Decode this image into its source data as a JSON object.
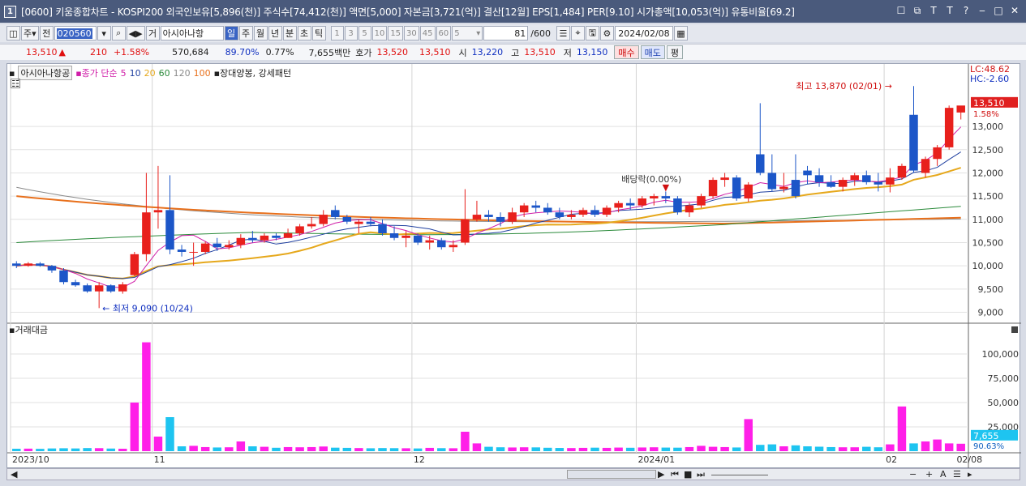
{
  "title": {
    "text": "[0600] 키움종합차트 - KOSPI200 외국인보유[5,896(천)] 주식수[74,412(천)] 액면[5,000] 자본금[3,721(억)] 결산[12월] EPS[1,484] PER[9.10] 시가총액[10,053(억)] 유통비율[69.2]",
    "icon": "1"
  },
  "toolbar": {
    "ju": "주",
    "jeon": "전",
    "code": "020560",
    "ge": "거",
    "stock_name": "아시아나항",
    "periods": [
      "일",
      "주",
      "월",
      "년",
      "분",
      "초",
      "틱"
    ],
    "active_period": "일",
    "numbers": [
      "1",
      "3",
      "5",
      "10",
      "15",
      "30",
      "45",
      "60"
    ],
    "n_value": "5",
    "count": "81",
    "count_total": "/600",
    "date": "2024/02/08"
  },
  "quote": {
    "price": "13,510",
    "change_arrow": "▲",
    "change": "210",
    "change_pct": "+1.58%",
    "volume": "570,684",
    "vol_ratio": "89.70%",
    "turnover": "0.77%",
    "amount": "7,655백만",
    "hoga_label": "호가",
    "ask": "13,520",
    "bid": "13,510",
    "open_label": "시",
    "open": "13,220",
    "high_label": "고",
    "high": "13,510",
    "low_label": "저",
    "low": "13,150",
    "buy_btn": "매수",
    "sell_btn": "매도",
    "eval_btn": "평"
  },
  "legend": {
    "name": "아시아나항공",
    "ma_label": "종가 단순",
    "ma": [
      "5",
      "10",
      "20",
      "60",
      "120",
      "100"
    ],
    "pattern": "장대양봉, 강세패턴",
    "volume_label": "거래대금"
  },
  "annotations": {
    "high": "최고 13,870 (02/01)",
    "low": "최저 9,090 (10/24)",
    "dividend": "배당락(0.00%)",
    "lc": "LC:48.62",
    "hc": "HC:-2.60",
    "last_price": "13,510",
    "last_pct": "1.58%",
    "last_vol": "7,655",
    "last_vol_pct": "90.63%"
  },
  "colors": {
    "up": "#e8201c",
    "down": "#1c56c8",
    "ma5": "#d01ea8",
    "ma10": "#2040a0",
    "ma20": "#e6a81c",
    "ma60": "#2a8a3a",
    "ma120": "#8a8a8a",
    "ma100": "#e8701c",
    "vol_up": "#ff1fe8",
    "vol_down": "#1ec4f0"
  },
  "chart_data": {
    "type": "candlestick",
    "price_ticks": [
      9000,
      9500,
      10000,
      10500,
      11000,
      11500,
      12000,
      12500,
      13000
    ],
    "price_tick_labels": [
      "9,000",
      "9,500",
      "10,000",
      "10,500",
      "11,000",
      "11,500",
      "12,000",
      "12,500",
      "13,000"
    ],
    "ylim": [
      8800,
      14100
    ],
    "volume_ticks": [
      25000,
      50000,
      75000,
      100000
    ],
    "volume_tick_labels": [
      "25,000",
      "50,000",
      "75,000",
      "100,000"
    ],
    "vol_ylim": [
      0,
      120000
    ],
    "x_labels": [
      {
        "index": 0,
        "text": "2023/10"
      },
      {
        "index": 12,
        "text": "11"
      },
      {
        "index": 34,
        "text": "12"
      },
      {
        "index": 53,
        "text": "2024/01"
      },
      {
        "index": 74,
        "text": "02"
      },
      {
        "index": 80,
        "text": "02/08"
      }
    ],
    "candles": [
      [
        10050,
        10100,
        9950,
        10000,
        2500
      ],
      [
        10000,
        10080,
        9980,
        10050,
        2600
      ],
      [
        10050,
        10080,
        9980,
        10000,
        2400
      ],
      [
        10000,
        10020,
        9850,
        9900,
        2800
      ],
      [
        9900,
        9950,
        9600,
        9650,
        3000
      ],
      [
        9650,
        9700,
        9550,
        9580,
        2800
      ],
      [
        9580,
        9620,
        9420,
        9450,
        3200
      ],
      [
        9450,
        9650,
        9090,
        9580,
        3100
      ],
      [
        9580,
        9600,
        9420,
        9450,
        2700
      ],
      [
        9450,
        9650,
        9400,
        9600,
        2500
      ],
      [
        9800,
        10300,
        9780,
        10250,
        50000
      ],
      [
        10250,
        12000,
        10100,
        11150,
        112000
      ],
      [
        11150,
        12150,
        10800,
        11200,
        15000
      ],
      [
        11200,
        11950,
        10250,
        10350,
        35000
      ],
      [
        10350,
        10450,
        10200,
        10300,
        5000
      ],
      [
        10300,
        10500,
        10000,
        10300,
        5500
      ],
      [
        10300,
        10520,
        10250,
        10480,
        4200
      ],
      [
        10480,
        10600,
        10320,
        10400,
        3800
      ],
      [
        10400,
        10550,
        10350,
        10450,
        4000
      ],
      [
        10450,
        10680,
        10380,
        10600,
        10000
      ],
      [
        10600,
        10750,
        10500,
        10550,
        5000
      ],
      [
        10550,
        10700,
        10500,
        10650,
        4500
      ],
      [
        10650,
        10700,
        10550,
        10600,
        3500
      ],
      [
        10600,
        10800,
        10600,
        10700,
        4200
      ],
      [
        10700,
        10900,
        10650,
        10850,
        4000
      ],
      [
        10850,
        11050,
        10800,
        10900,
        4200
      ],
      [
        10900,
        11200,
        10850,
        11100,
        4800
      ],
      [
        11200,
        11300,
        11000,
        11050,
        3600
      ],
      [
        11050,
        11100,
        10900,
        10950,
        3400
      ],
      [
        10900,
        11000,
        10700,
        10950,
        3200
      ],
      [
        10950,
        11050,
        10850,
        10900,
        3000
      ],
      [
        10900,
        11000,
        10650,
        10700,
        3200
      ],
      [
        10700,
        10850,
        10550,
        10600,
        3100
      ],
      [
        10600,
        10750,
        10400,
        10650,
        3000
      ],
      [
        10650,
        10700,
        10450,
        10500,
        2800
      ],
      [
        10500,
        10650,
        10350,
        10550,
        3400
      ],
      [
        10550,
        10600,
        10350,
        10400,
        3100
      ],
      [
        10400,
        10550,
        10300,
        10450,
        3000
      ],
      [
        10500,
        11650,
        10450,
        11000,
        20000
      ],
      [
        11000,
        11400,
        10950,
        11100,
        8000
      ],
      [
        11100,
        11200,
        10950,
        11050,
        4500
      ],
      [
        11050,
        11150,
        10850,
        10950,
        4000
      ],
      [
        10950,
        11250,
        10900,
        11150,
        3800
      ],
      [
        11150,
        11350,
        11050,
        11300,
        4000
      ],
      [
        11300,
        11400,
        11150,
        11250,
        3900
      ],
      [
        11250,
        11350,
        11100,
        11150,
        3500
      ],
      [
        11150,
        11250,
        11000,
        11050,
        3300
      ],
      [
        11050,
        11200,
        11000,
        11100,
        3200
      ],
      [
        11100,
        11250,
        11050,
        11200,
        3400
      ],
      [
        11200,
        11300,
        11050,
        11100,
        3600
      ],
      [
        11100,
        11300,
        11050,
        11250,
        3400
      ],
      [
        11250,
        11400,
        11150,
        11350,
        3700
      ],
      [
        11350,
        11450,
        11200,
        11300,
        3500
      ],
      [
        11300,
        11500,
        11250,
        11450,
        3800
      ],
      [
        11450,
        11550,
        11300,
        11500,
        4000
      ],
      [
        11500,
        11600,
        11350,
        11450,
        3700
      ],
      [
        11450,
        11500,
        11100,
        11150,
        3600
      ],
      [
        11150,
        11350,
        11050,
        11300,
        4200
      ],
      [
        11300,
        11550,
        11250,
        11500,
        5500
      ],
      [
        11500,
        11900,
        11450,
        11850,
        4500
      ],
      [
        11850,
        12000,
        11700,
        11900,
        4200
      ],
      [
        11900,
        11950,
        11400,
        11450,
        3800
      ],
      [
        11450,
        11800,
        11380,
        11750,
        33000
      ],
      [
        12400,
        13500,
        11950,
        12000,
        6500
      ],
      [
        12000,
        12400,
        11600,
        11650,
        7000
      ],
      [
        11650,
        12000,
        11580,
        11700,
        5000
      ],
      [
        11500,
        12400,
        11450,
        11850,
        6000
      ],
      [
        12050,
        12150,
        11750,
        11950,
        5000
      ],
      [
        11950,
        12100,
        11700,
        11800,
        4600
      ],
      [
        11800,
        11950,
        11680,
        11700,
        4200
      ],
      [
        11700,
        11900,
        11600,
        11850,
        4000
      ],
      [
        11850,
        12000,
        11720,
        11950,
        4000
      ],
      [
        11950,
        12050,
        11750,
        11800,
        4500
      ],
      [
        11800,
        12000,
        11600,
        11750,
        4000
      ],
      [
        11750,
        12100,
        11580,
        11900,
        7000
      ],
      [
        11900,
        12200,
        11850,
        12150,
        46000
      ],
      [
        12050,
        13870,
        12000,
        13250,
        8000
      ],
      [
        12000,
        12350,
        11900,
        12300,
        10000
      ],
      [
        12300,
        12600,
        12150,
        12550,
        12000
      ],
      [
        12550,
        13450,
        12500,
        13400,
        8000
      ],
      [
        13300,
        13400,
        13150,
        13450,
        7655
      ]
    ],
    "candle_dirs": [
      -1,
      1,
      -1,
      -1,
      -1,
      -1,
      -1,
      1,
      -1,
      1,
      1,
      1,
      1,
      -1,
      -1,
      1,
      1,
      -1,
      1,
      1,
      -1,
      1,
      -1,
      1,
      1,
      1,
      1,
      -1,
      -1,
      1,
      -1,
      -1,
      -1,
      1,
      -1,
      1,
      -1,
      1,
      1,
      1,
      -1,
      -1,
      1,
      1,
      -1,
      -1,
      -1,
      1,
      1,
      -1,
      1,
      1,
      -1,
      1,
      1,
      -1,
      -1,
      1,
      1,
      1,
      1,
      -1,
      1,
      -1,
      -1,
      1,
      -1,
      -1,
      -1,
      -1,
      1,
      1,
      -1,
      -1,
      1,
      1,
      -1,
      1,
      1,
      1,
      1
    ]
  }
}
